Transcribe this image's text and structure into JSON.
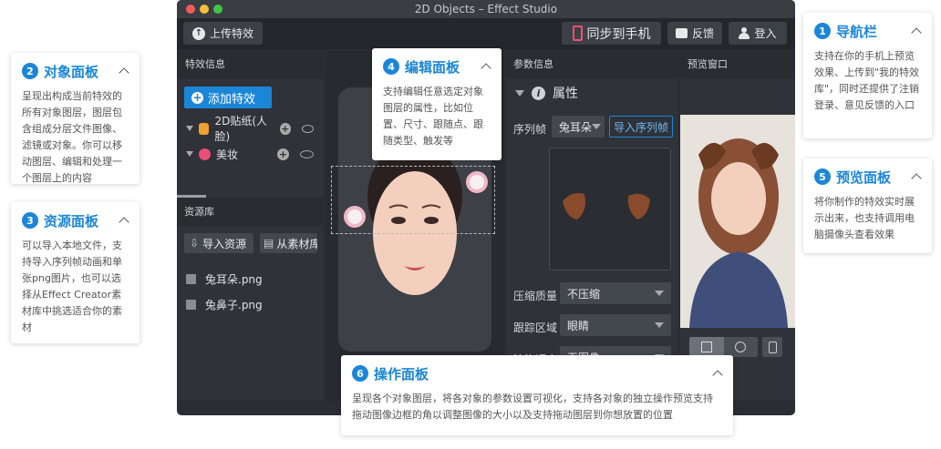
{
  "window": {
    "title": "2D Objects – Effect Studio"
  },
  "toolbar": {
    "upload": "上传特效",
    "sync_phone": "同步到手机",
    "feedback": "反馈",
    "login": "登入"
  },
  "object_panel": {
    "header": "特效信息",
    "add_button": "添加特效",
    "layers": [
      {
        "name": "2D贴纸(人脸)"
      },
      {
        "name": "美妆"
      }
    ]
  },
  "resource_panel": {
    "header": "资源库",
    "import_resource": "导入资源",
    "import_library": "从素材库导入",
    "files": [
      {
        "name": "兔耳朵.png"
      },
      {
        "name": "兔鼻子.png"
      }
    ]
  },
  "param_panel": {
    "header": "参数信息",
    "section": "属性",
    "seq_label": "序列帧",
    "seq_value": "兔耳朵",
    "import_seq": "导入序列帧",
    "compress_label": "压缩质量",
    "compress_value": "不压缩",
    "track_label": "跟踪区域",
    "track_value": "眼睛",
    "partial_label": "渲染顺序",
    "partial_value": "无图像"
  },
  "preview_panel": {
    "header": "预览窗口"
  },
  "tips": {
    "nav": {
      "num": "1",
      "title": "导航栏",
      "body": "支持在你的手机上预览效果、上传到\"我的特效库\"，同时还提供了注销登录、意见反馈的入口"
    },
    "object": {
      "num": "2",
      "title": "对象面板",
      "body": "呈现出构成当前特效的所有对象图层，图层包含组成分层文件图像、滤镜或对象。你可以移动图层、编辑和处理一个图层上的内容"
    },
    "resource": {
      "num": "3",
      "title": "资源面板",
      "body": "可以导入本地文件，支持导入序列帧动画和单张png图片，也可以选择从Effect Creator素材库中挑选适合你的素材"
    },
    "edit": {
      "num": "4",
      "title": "编辑面板",
      "body": "支持编辑任意选定对象图层的属性，比如位置、尺寸、跟随点、跟随类型、触发等"
    },
    "preview": {
      "num": "5",
      "title": "预览面板",
      "body": "将你制作的特效实时展示出来，也支持调用电脑摄像头查看效果"
    },
    "operate": {
      "num": "6",
      "title": "操作面板",
      "body": "呈现各个对象图层，将各对象的参数设置可视化，支持各对象的独立操作预览支持拖动图像边框的角以调整图像的大小以及支持拖动图层到你想放置的位置"
    }
  },
  "colors": {
    "accent": "#1b86d8",
    "window_bg": "#2a2d33",
    "panel_bg": "#2f3238"
  }
}
